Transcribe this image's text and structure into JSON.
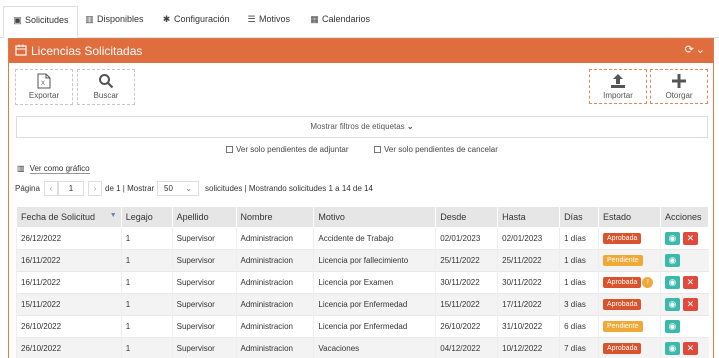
{
  "tabs": [
    {
      "label": "Solicitudes",
      "icon": "inbox-icon"
    },
    {
      "label": "Disponibles",
      "icon": "bar-chart-icon"
    },
    {
      "label": "Configuración",
      "icon": "gear-icon"
    },
    {
      "label": "Motivos",
      "icon": "list-icon"
    },
    {
      "label": "Calendarios",
      "icon": "calendar-icon"
    }
  ],
  "panel": {
    "title": "Licencias Solicitadas"
  },
  "toolbar": {
    "export_label": "Exportar",
    "search_label": "Buscar",
    "import_label": "Importar",
    "grant_label": "Otorgar"
  },
  "filters": {
    "toggle_label": "Mostrar filtros de etiquetas",
    "pending_attach": "Ver solo pendientes de adjuntar",
    "pending_cancel": "Ver solo pendientes de cancelar"
  },
  "graph_link": "Ver como gráfico",
  "pager": {
    "page_label": "Página",
    "page_value": "1",
    "of_text": "de 1 | Mostrar",
    "size_value": "50",
    "summary": "solicitudes | Mostrando solicitudes 1 a 14 de 14"
  },
  "table": {
    "columns": [
      "Fecha de Solicitud",
      "Legajo",
      "Apellido",
      "Nombre",
      "Motivo",
      "Desde",
      "Hasta",
      "Días",
      "Estado",
      "Acciones"
    ],
    "rows": [
      {
        "fecha": "26/12/2022",
        "legajo": "1",
        "apellido": "Supervisor",
        "nombre": "Administracion",
        "motivo": "Accidente de Trabajo",
        "desde": "02/01/2023",
        "hasta": "02/01/2023",
        "dias": "1 días",
        "estado": "Aprobada",
        "warning": false,
        "delete": true
      },
      {
        "fecha": "16/11/2022",
        "legajo": "1",
        "apellido": "Supervisor",
        "nombre": "Administracion",
        "motivo": "Licencia por fallecimiento",
        "desde": "25/11/2022",
        "hasta": "25/11/2022",
        "dias": "1 días",
        "estado": "Pendiente",
        "warning": false,
        "delete": false
      },
      {
        "fecha": "16/11/2022",
        "legajo": "1",
        "apellido": "Supervisor",
        "nombre": "Administracion",
        "motivo": "Licencia por Examen",
        "desde": "30/11/2022",
        "hasta": "30/11/2022",
        "dias": "1 días",
        "estado": "Aprobada",
        "warning": true,
        "delete": true
      },
      {
        "fecha": "15/11/2022",
        "legajo": "1",
        "apellido": "Supervisor",
        "nombre": "Administracion",
        "motivo": "Licencia por Enfermedad",
        "desde": "15/11/2022",
        "hasta": "17/11/2022",
        "dias": "3 días",
        "estado": "Aprobada",
        "warning": false,
        "delete": true
      },
      {
        "fecha": "26/10/2022",
        "legajo": "1",
        "apellido": "Supervisor",
        "nombre": "Administracion",
        "motivo": "Licencia por Enfermedad",
        "desde": "26/10/2022",
        "hasta": "31/10/2022",
        "dias": "6 días",
        "estado": "Pendiente",
        "warning": false,
        "delete": false
      },
      {
        "fecha": "26/10/2022",
        "legajo": "1",
        "apellido": "Supervisor",
        "nombre": "Administracion",
        "motivo": "Vacaciones",
        "desde": "04/12/2022",
        "hasta": "10/12/2022",
        "dias": "7 días",
        "estado": "Aprobada",
        "warning": false,
        "delete": true
      }
    ]
  },
  "colors": {
    "brand": "#e06d3d",
    "approved": "#d9532c",
    "pending": "#f0a935",
    "view": "#3cb9ad",
    "delete": "#e04a3c"
  }
}
